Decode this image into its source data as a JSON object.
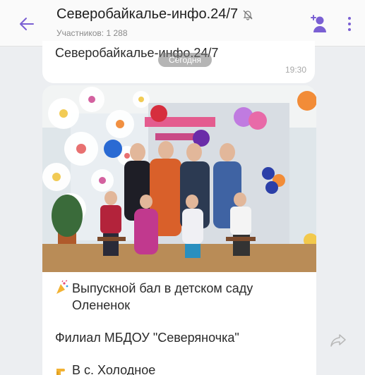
{
  "header": {
    "title": "Северобайкалье-инфо.24/7",
    "subtitle": "Участников: 1 288",
    "accent_color": "#7a5fd3",
    "icons": {
      "back": "arrow-left-icon",
      "mute": "muted-bell-icon",
      "add_member": "add-member-icon",
      "menu": "more-vertical-icon"
    }
  },
  "previous_message": {
    "text": "Северобайкалье-инфо.24/7",
    "time": "19:30"
  },
  "date_pill": "Сегодня",
  "message": {
    "image_alt": "group-photo",
    "line1_emoji": "party-popper-icon",
    "line1": "Выпускной бал в детском саду Олененок",
    "line2": "Филиал МБДОУ \"Северяночка\"",
    "line3_emoji": "pointing-hand-icon",
    "line3": "В с. Холодное"
  },
  "share_icon": "share-icon"
}
